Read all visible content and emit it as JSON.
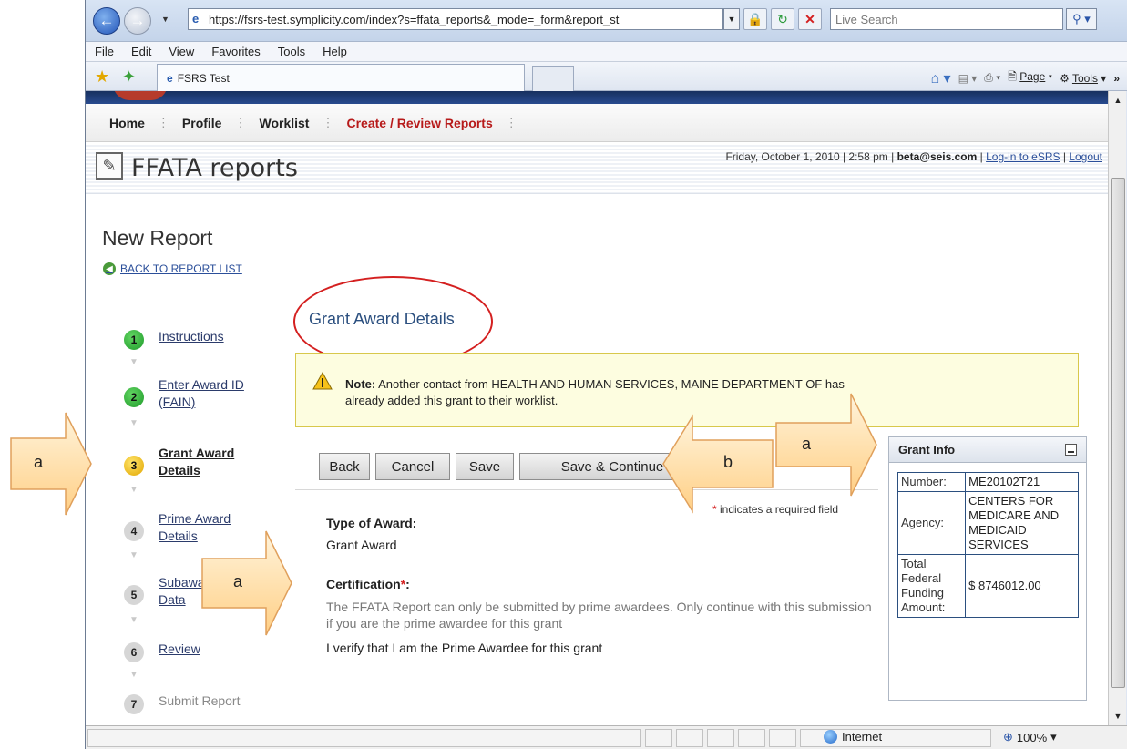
{
  "browser": {
    "url": "https://fsrs-test.symplicity.com/index?s=ffata_reports&_mode=_form&report_st",
    "search_placeholder": "Live Search",
    "menu": [
      "File",
      "Edit",
      "View",
      "Favorites",
      "Tools",
      "Help"
    ],
    "tab_title": "FSRS Test",
    "cmd_page": "Page",
    "cmd_tools": "Tools",
    "status_zone": "Internet",
    "status_zoom": "100%"
  },
  "site": {
    "nav": [
      "Home",
      "Profile",
      "Worklist",
      "Create / Review Reports"
    ],
    "app_title": "FFATA reports",
    "datetime": "Friday, October 1, 2010 | 2:58 pm |",
    "user": "beta@seis.com",
    "login_esrs": "Log-in to eSRS",
    "logout": "Logout"
  },
  "report": {
    "heading": "New Report",
    "back_link": "BACK TO REPORT LIST",
    "steps": [
      {
        "num": "1",
        "label": "Instructions"
      },
      {
        "num": "2",
        "label": "Enter Award ID (FAIN)"
      },
      {
        "num": "3",
        "label": "Grant Award Details"
      },
      {
        "num": "4",
        "label": "Prime Award Details"
      },
      {
        "num": "5",
        "label": "Subaward Data"
      },
      {
        "num": "6",
        "label": "Review"
      },
      {
        "num": "7",
        "label": "Submit Report"
      }
    ],
    "section_title": "Grant Award Details",
    "note_label": "Note:",
    "note_text": " Another contact from HEALTH AND HUMAN SERVICES, MAINE DEPARTMENT OF has",
    "note_text_2": "already added this grant to their worklist.",
    "buttons": {
      "back": "Back",
      "cancel": "Cancel",
      "save": "Save",
      "save_continue": "Save & Continue"
    },
    "required_note": " indicates a required field",
    "type_label": "Type of Award:",
    "type_value": "Grant Award",
    "cert_label": "Certification",
    "cert_text": "The FFATA Report can only be submitted by prime awardees. Only continue with this submission if you are the prime awardee for this grant",
    "verify_text": "I verify that I am the Prime Awardee for this grant"
  },
  "grant_info": {
    "title": "Grant Info",
    "number_label": "Number:",
    "number_value": "ME20102T21",
    "agency_label": "Agency:",
    "agency_value": "CENTERS FOR MEDICARE AND MEDICAID SERVICES",
    "funding_label": "Total Federal Funding Amount:",
    "funding_value": "$ 8746012.00"
  },
  "callouts": {
    "a": "a",
    "b": "b"
  }
}
